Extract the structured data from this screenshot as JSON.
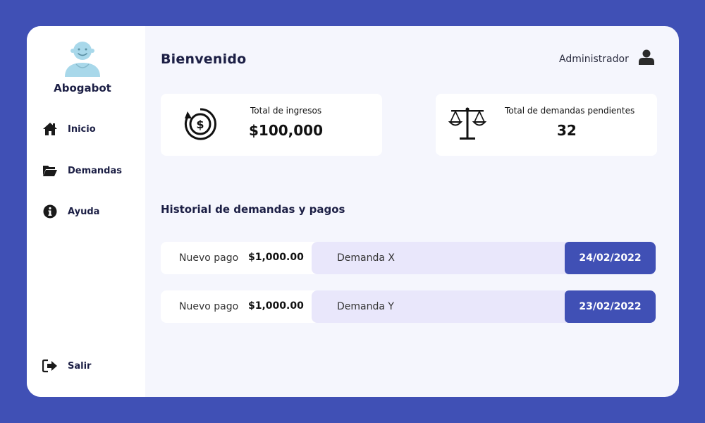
{
  "sidebar": {
    "brand": "Abogabot",
    "items": [
      {
        "label": "Inicio",
        "icon": "home-icon"
      },
      {
        "label": "Demandas",
        "icon": "folder-open-icon"
      },
      {
        "label": "Ayuda",
        "icon": "info-icon"
      }
    ],
    "logout": {
      "label": "Salir",
      "icon": "sign-out-icon"
    }
  },
  "header": {
    "title": "Bienvenido",
    "user_label": "Administrador",
    "user_icon": "user-icon"
  },
  "cards": [
    {
      "title": "Total de ingresos",
      "value": "$100,000",
      "icon": "dollar-coin-icon"
    },
    {
      "title": "Total de demandas pendientes",
      "value": "32",
      "icon": "scales-icon"
    }
  ],
  "history": {
    "title": "Historial de demandas y pagos",
    "rows": [
      {
        "type": "Nuevo pago",
        "amount": "$1,000.00",
        "demand": "Demanda X",
        "date": "24/02/2022"
      },
      {
        "type": "Nuevo pago",
        "amount": "$1,000.00",
        "demand": "Demanda Y",
        "date": "23/02/2022"
      }
    ]
  },
  "colors": {
    "accent": "#4050b5",
    "text_dark": "#1c1f45",
    "row_highlight": "#e9e7fb"
  }
}
